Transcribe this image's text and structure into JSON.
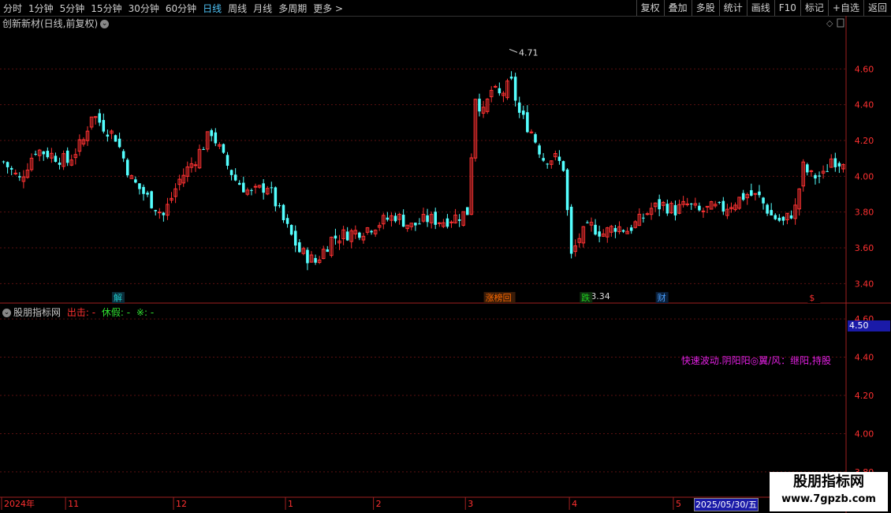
{
  "periods": [
    "分时",
    "1分钟",
    "5分钟",
    "15分钟",
    "30分钟",
    "60分钟",
    "日线",
    "周线",
    "月线",
    "多周期",
    "更多 >"
  ],
  "active_period": "日线",
  "tools": [
    "复权",
    "叠加",
    "多股",
    "统计",
    "画线",
    "F10",
    "标记",
    "+自选",
    "返回"
  ],
  "main_title": "创新新材(日线,前复权)",
  "indicator": {
    "name": "股朋指标网",
    "label1": "出击: -",
    "label2": "休假: -",
    "label3": "※: -",
    "signal_text": "快速波动.阴阳阳◎翼/风：继阳,持股",
    "price_badge": "4.50"
  },
  "annotations": {
    "high": "4.71",
    "low": "3.34"
  },
  "markers": [
    {
      "text": "解",
      "color": "#1ec8c8",
      "bg": "#0b2d3a",
      "idx": 28
    },
    {
      "text": "涨榜回",
      "color": "#ff6a00",
      "bg": "#3a1c08",
      "idx": 121
    },
    {
      "text": "跌",
      "color": "#20d020",
      "bg": "#0f2e0f",
      "idx": 145
    },
    {
      "text": "财",
      "color": "#4aa0ff",
      "bg": "#0a1f3a",
      "idx": 164
    },
    {
      "text": "$",
      "color": "#ff3030",
      "bg": "#000",
      "idx": 202
    }
  ],
  "x_labels": [
    {
      "text": "2024年",
      "idx": 0
    },
    {
      "text": "11",
      "idx": 16
    },
    {
      "text": "12",
      "idx": 43
    },
    {
      "text": "1",
      "idx": 71
    },
    {
      "text": "2",
      "idx": 93
    },
    {
      "text": "3",
      "idx": 116
    },
    {
      "text": "4",
      "idx": 142
    },
    {
      "text": "5",
      "idx": 168
    }
  ],
  "date_box": "2025/05/30/五",
  "watermark": {
    "line1": "股朋指标网",
    "line2": "www.7gpzb.com"
  },
  "chart_data": {
    "type": "candlestick",
    "title": "创新新材(日线,前复权)",
    "ylim": [
      3.3,
      4.8
    ],
    "y_ticks": [
      "4.60",
      "4.40",
      "4.20",
      "4.00",
      "3.80",
      "3.60",
      "3.40"
    ],
    "sub_ylim": [
      3.75,
      4.65
    ],
    "sub_y_ticks": [
      "4.60",
      "4.40",
      "4.20",
      "4.00",
      "3.80"
    ],
    "anchors": [
      [
        0,
        4.08
      ],
      [
        4,
        3.98
      ],
      [
        8,
        4.15
      ],
      [
        12,
        4.12
      ],
      [
        16,
        4.08
      ],
      [
        20,
        4.2
      ],
      [
        22,
        4.35
      ],
      [
        25,
        4.28
      ],
      [
        28,
        4.22
      ],
      [
        32,
        3.98
      ],
      [
        36,
        3.88
      ],
      [
        40,
        3.78
      ],
      [
        44,
        3.98
      ],
      [
        48,
        4.1
      ],
      [
        52,
        4.25
      ],
      [
        55,
        4.1
      ],
      [
        58,
        3.98
      ],
      [
        62,
        3.9
      ],
      [
        66,
        3.95
      ],
      [
        70,
        3.75
      ],
      [
        74,
        3.58
      ],
      [
        78,
        3.52
      ],
      [
        82,
        3.65
      ],
      [
        86,
        3.68
      ],
      [
        90,
        3.7
      ],
      [
        94,
        3.74
      ],
      [
        98,
        3.78
      ],
      [
        102,
        3.72
      ],
      [
        106,
        3.76
      ],
      [
        110,
        3.75
      ],
      [
        114,
        3.78
      ],
      [
        116,
        3.8
      ],
      [
        118,
        4.45
      ],
      [
        120,
        4.35
      ],
      [
        122,
        4.48
      ],
      [
        124,
        4.45
      ],
      [
        127,
        4.52
      ],
      [
        129,
        4.35
      ],
      [
        132,
        4.25
      ],
      [
        135,
        4.1
      ],
      [
        138,
        4.1
      ],
      [
        140,
        4.05
      ],
      [
        142,
        3.55
      ],
      [
        144,
        3.66
      ],
      [
        147,
        3.72
      ],
      [
        150,
        3.68
      ],
      [
        153,
        3.72
      ],
      [
        156,
        3.7
      ],
      [
        159,
        3.75
      ],
      [
        162,
        3.82
      ],
      [
        165,
        3.84
      ],
      [
        168,
        3.81
      ],
      [
        171,
        3.84
      ],
      [
        174,
        3.8
      ],
      [
        177,
        3.82
      ],
      [
        180,
        3.82
      ],
      [
        183,
        3.86
      ],
      [
        186,
        3.9
      ],
      [
        189,
        3.88
      ],
      [
        192,
        3.78
      ],
      [
        195,
        3.74
      ],
      [
        198,
        3.82
      ],
      [
        200,
        4.05
      ],
      [
        202,
        4.0
      ],
      [
        205,
        4.0
      ],
      [
        207,
        4.1
      ],
      [
        209,
        4.08
      ],
      [
        210,
        4.1
      ]
    ],
    "n_candles": 211,
    "series_color_up": "#ff3232",
    "series_color_down": "#54ffff"
  }
}
